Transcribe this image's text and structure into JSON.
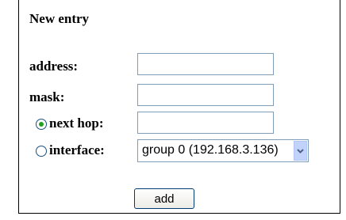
{
  "form": {
    "title": "New entry",
    "address_label": "address:",
    "address_value": "",
    "mask_label": "mask:",
    "mask_value": "",
    "next_hop_label": "next hop:",
    "next_hop_value": "",
    "interface_label": "interface:",
    "interface_selected": "group 0 (192.168.3.136)",
    "route_type_selected": "next hop",
    "add_label": "add"
  }
}
